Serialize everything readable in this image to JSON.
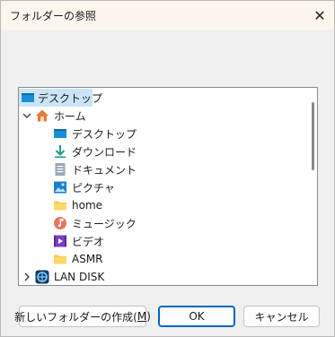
{
  "window": {
    "title": "フォルダーの参照",
    "close_glyph": "✕"
  },
  "tree": {
    "items": [
      {
        "label": "デスクトップ",
        "icon": "desktop-icon",
        "selected": true
      },
      {
        "label": "ホーム",
        "icon": "home-icon",
        "expanded": true
      },
      {
        "label": "デスクトップ",
        "icon": "desktop-icon"
      },
      {
        "label": "ダウンロード",
        "icon": "download-icon"
      },
      {
        "label": "ドキュメント",
        "icon": "document-icon"
      },
      {
        "label": "ピクチャ",
        "icon": "pictures-icon"
      },
      {
        "label": "home",
        "icon": "folder-icon"
      },
      {
        "label": "ミュージック",
        "icon": "music-icon"
      },
      {
        "label": "ビデオ",
        "icon": "video-icon"
      },
      {
        "label": "ASMR",
        "icon": "folder-icon"
      },
      {
        "label": "LAN DISK",
        "icon": "network-drive-icon",
        "expanded": false
      }
    ]
  },
  "buttons": {
    "new_folder_prefix": "新しいフォルダーの作成(",
    "new_folder_key": "M",
    "new_folder_suffix": ")",
    "ok": "OK",
    "cancel": "キャンセル"
  },
  "colors": {
    "accent": "#0067c0",
    "selection": "#cce4f7",
    "folder": "#f8c94b"
  }
}
